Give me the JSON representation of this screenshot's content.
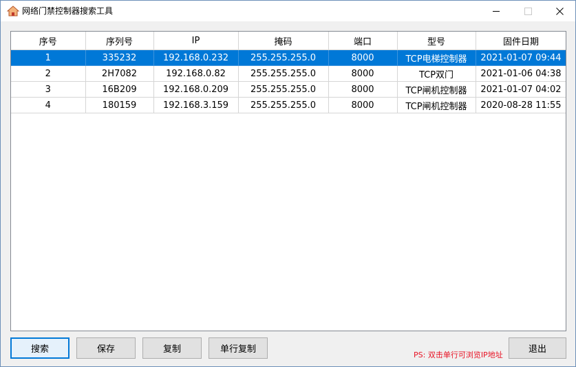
{
  "window": {
    "title": "网络门禁控制器搜索工具",
    "app_icon": "house-icon",
    "controls": {
      "minimize": "minimize-icon",
      "maximize": "maximize-icon",
      "close": "close-icon"
    }
  },
  "table": {
    "headers": [
      "序号",
      "序列号",
      "IP",
      "掩码",
      "端口",
      "型号",
      "固件日期"
    ],
    "rows": [
      [
        "1",
        "335232",
        "192.168.0.232",
        "255.255.255.0",
        "8000",
        "TCP电梯控制器",
        "2021-01-07 09:44"
      ],
      [
        "2",
        "2H7082",
        "192.168.0.82",
        "255.255.255.0",
        "8000",
        "TCP双门",
        "2021-01-06 04:38"
      ],
      [
        "3",
        "16B209",
        "192.168.0.209",
        "255.255.255.0",
        "8000",
        "TCP闸机控制器",
        "2021-01-07 04:02"
      ],
      [
        "4",
        "180159",
        "192.168.3.159",
        "255.255.255.0",
        "8000",
        "TCP闸机控制器",
        "2020-08-28 11:55"
      ]
    ],
    "selected_row": 0
  },
  "buttons": {
    "search": "搜索",
    "save": "保存",
    "copy": "复制",
    "copy_row": "单行复制",
    "exit": "退出"
  },
  "hint": "PS: 双击单行可浏览IP地址",
  "colors": {
    "selection": "#0078d7",
    "hint": "#e81123",
    "focus_border": "#0078d7"
  }
}
